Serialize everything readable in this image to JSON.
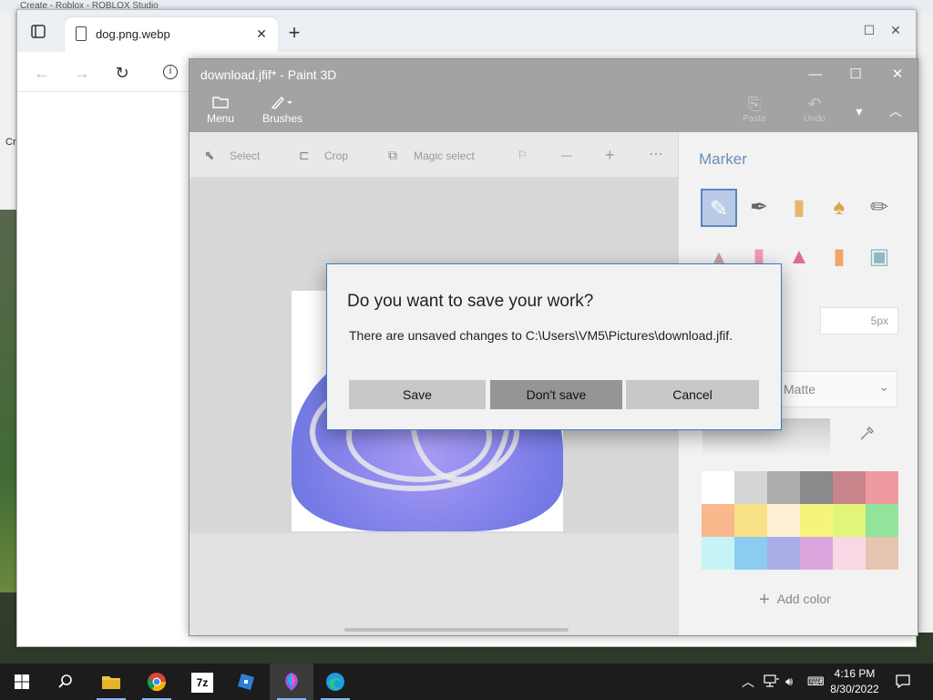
{
  "background": {
    "top_app_title": "Create - Roblox - ROBLOX Studio",
    "left_partial_label": "Cr"
  },
  "browser": {
    "tab_title": "dog.png.webp",
    "tab_close": "✕",
    "new_tab": "+",
    "minimize": "—",
    "maximize": "☐",
    "close": "✕",
    "back": "←",
    "forward": "→",
    "refresh": "↻",
    "info": "i"
  },
  "paint": {
    "window_title": "download.jfif* - Paint 3D",
    "minimize": "—",
    "maximize": "☐",
    "close": "✕",
    "ribbon": {
      "menu_label": "Menu",
      "brushes_label": "Brushes",
      "paste_label": "Paste",
      "undo_label": "Undo"
    },
    "toolbar": {
      "select_label": "Select",
      "crop_label": "Crop",
      "magic_select_label": "Magic select"
    },
    "side_panel": {
      "title": "Marker",
      "thickness_value": "5px",
      "finish_value": "Matte",
      "add_color_label": "Add color"
    },
    "palette": [
      "#ffffff",
      "#d6d6d6",
      "#acacac",
      "#8a8a8a",
      "#c9848c",
      "#ef9a9f",
      "#f9b98c",
      "#f8e184",
      "#fcf1d5",
      "#f7f47c",
      "#e1f57a",
      "#93e49a",
      "#c6f4f6",
      "#8bcdf2",
      "#aaaee8",
      "#dba6de",
      "#f9d7e4",
      "#e5c5b2"
    ]
  },
  "dialog": {
    "title": "Do you want to save your work?",
    "message": "There are unsaved changes to C:\\Users\\VM5\\Pictures\\download.jfif.",
    "save_label": "Save",
    "dont_save_label": "Don't save",
    "cancel_label": "Cancel"
  },
  "taskbar": {
    "time": "4:16 PM",
    "date": "8/30/2022",
    "zip_label": "7z"
  },
  "colors": {
    "accent": "#3b79c9",
    "paint_chrome": "#a3a3a3",
    "focused_button": "#959595"
  }
}
